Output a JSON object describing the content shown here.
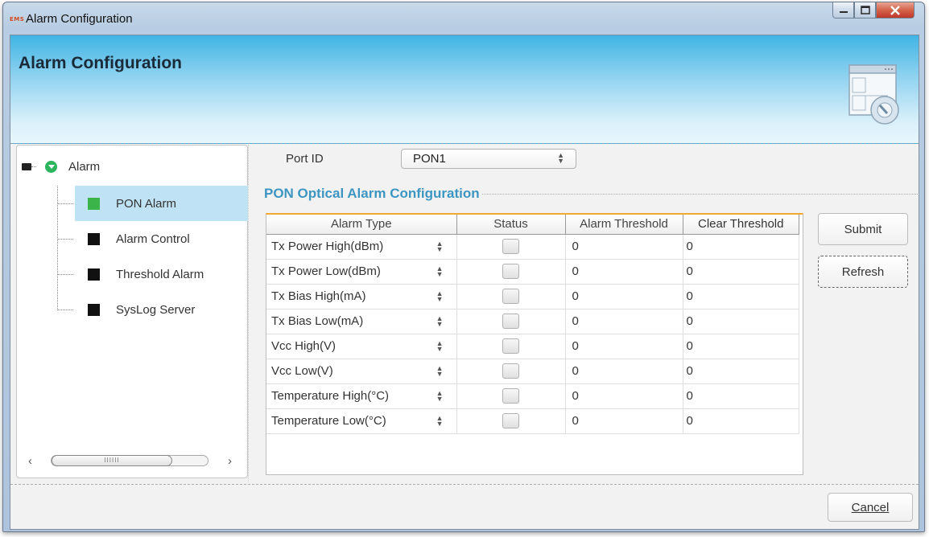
{
  "window": {
    "app_badge": "EMS",
    "title": "Alarm Configuration",
    "controls": [
      "minimize",
      "maximize",
      "close"
    ]
  },
  "header": {
    "title": "Alarm Configuration",
    "icon": "config-window-icon"
  },
  "tree": {
    "root_label": "Alarm",
    "items": [
      {
        "label": "PON Alarm",
        "selected": true,
        "color": "#3bb54a"
      },
      {
        "label": "Alarm Control",
        "selected": false,
        "color": "#111111"
      },
      {
        "label": "Threshold Alarm",
        "selected": false,
        "color": "#111111"
      },
      {
        "label": "SysLog Server",
        "selected": false,
        "color": "#111111"
      }
    ],
    "scroll_thumb": "IIIIII"
  },
  "port": {
    "label": "Port ID",
    "value": "PON1"
  },
  "section": {
    "title": "PON Optical Alarm Configuration"
  },
  "table": {
    "columns": [
      "Alarm Type",
      "Status",
      "Alarm Threshold",
      "Clear Threshold"
    ],
    "rows": [
      {
        "type": "Tx Power High(dBm)",
        "alarm": "0",
        "clear": "0"
      },
      {
        "type": "Tx Power Low(dBm)",
        "alarm": "0",
        "clear": "0"
      },
      {
        "type": "Tx Bias High(mA)",
        "alarm": "0",
        "clear": "0"
      },
      {
        "type": "Tx Bias Low(mA)",
        "alarm": "0",
        "clear": "0"
      },
      {
        "type": "Vcc High(V)",
        "alarm": "0",
        "clear": "0"
      },
      {
        "type": "Vcc Low(V)",
        "alarm": "0",
        "clear": "0"
      },
      {
        "type": "Temperature High(°C)",
        "alarm": "0",
        "clear": "0"
      },
      {
        "type": "Temperature Low(°C)",
        "alarm": "0",
        "clear": "0"
      }
    ]
  },
  "buttons": {
    "submit": "Submit",
    "refresh": "Refresh",
    "cancel": "Cancel"
  },
  "colors": {
    "header_gradient_top": "#3fb4e4",
    "section_title": "#3d95c2",
    "selection": "#bfe3f4",
    "table_top_border": "#f0a830"
  }
}
